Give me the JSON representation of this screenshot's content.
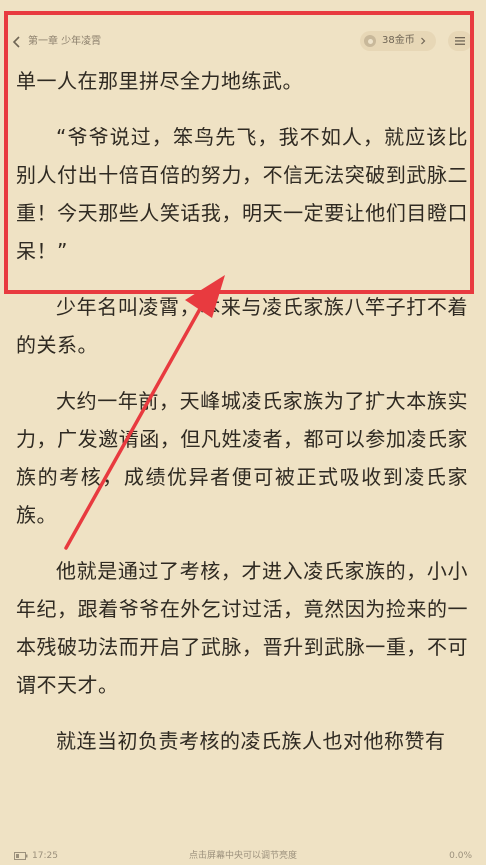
{
  "header": {
    "chapter_title": "第一章 少年凌霄",
    "coins_label": "38金币"
  },
  "content": {
    "paragraphs": [
      "单一人在那里拼尽全力地练武。",
      "“爷爷说过，笨鸟先飞，我不如人，就应该比别人付出十倍百倍的努力，不信无法突破到武脉二重！今天那些人笑话我，明天一定要让他们目瞪口呆！”",
      "少年名叫凌霄，本来与凌氏家族八竿子打不着的关系。",
      "大约一年前，天峰城凌氏家族为了扩大本族实力，广发邀请函，但凡姓凌者，都可以参加凌氏家族的考核，成绩优异者便可被正式吸收到凌氏家族。",
      "他就是通过了考核，才进入凌氏家族的，小小年纪，跟着爷爷在外乞讨过活，竟然因为捡来的一本残破功法而开启了武脉，晋升到武脉一重，不可谓不天才。",
      "就连当初负责考核的凌氏族人也对他称赞有"
    ]
  },
  "footer": {
    "time": "17:25",
    "hint": "点击屏幕中央可以调节亮度",
    "progress": "0.0%"
  },
  "colors": {
    "background": "#efe2c4",
    "text": "#2f2a22",
    "annotation_red": "#e83a3f"
  }
}
